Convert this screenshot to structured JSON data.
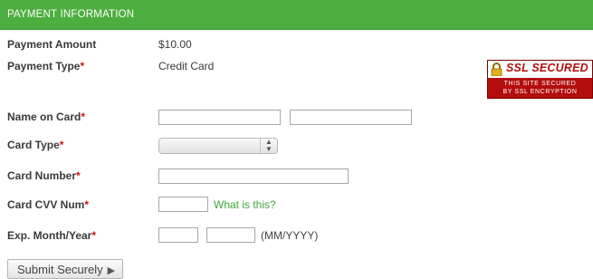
{
  "header": {
    "title": "PAYMENT INFORMATION"
  },
  "summary": {
    "amount_label": "Payment Amount",
    "amount_value": "$10.00",
    "type_label": "Payment Type",
    "type_value": "Credit Card",
    "required_mark": "*"
  },
  "ssl_badge": {
    "title": "SSL SECURED",
    "line1": "THIS SITE SECURED",
    "line2": "BY SSL ENCRYPTION",
    "icon": "lock-icon"
  },
  "form": {
    "name_label": "Name on Card",
    "first_name_value": "",
    "last_name_value": "",
    "card_type_label": "Card Type",
    "card_type_selected": "",
    "card_number_label": "Card Number",
    "card_number_value": "",
    "cvv_label": "Card CVV Num",
    "cvv_value": "",
    "cvv_help_link": "What is this?",
    "exp_label": "Exp. Month/Year",
    "exp_month_value": "",
    "exp_year_value": "",
    "exp_hint": "(MM/YYYY)"
  },
  "actions": {
    "submit_label": "Submit Securely",
    "submit_icon": "play-arrow-icon"
  },
  "colors": {
    "header_bg": "#4cae3e",
    "required": "#cc1111",
    "link": "#3fa53a",
    "ssl_red": "#b30d0d"
  }
}
